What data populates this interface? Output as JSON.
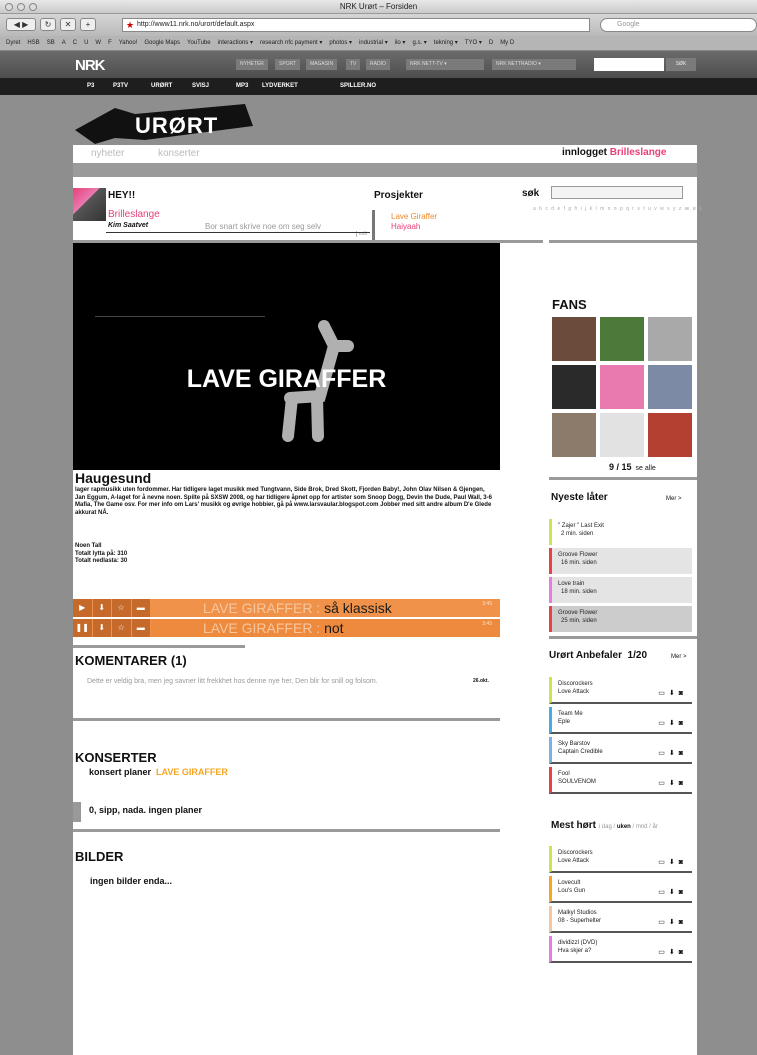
{
  "browser": {
    "window_title": "NRK Urørt – Forsiden",
    "url": "http://www11.nrk.no/urort/default.aspx",
    "search_placeholder": "Google",
    "bookmarks": [
      "Dyret",
      "HSB",
      "SB",
      "A",
      "C",
      "U",
      "W",
      "F",
      "Yahoo!",
      "Google Maps",
      "YouTube",
      "interactions ▾",
      "research nfc payment ▾",
      "photos ▾",
      "industrial ▾",
      "ilo ▾",
      "g.s. ▾",
      "tekning ▾",
      "TYO ▾",
      "D",
      "My D"
    ]
  },
  "nrk": {
    "logo": "NRK",
    "top_buttons": [
      "NYHETER",
      "SPORT",
      "MAGASIN",
      "TV",
      "RADIO"
    ],
    "dropdowns": [
      "NRK NETT-TV",
      "NRK NETTRADIO"
    ],
    "search_button": "SØK",
    "nav": [
      "P3",
      "P3TV",
      "URØRT",
      "SVISJ",
      "MP3",
      "LYDVERKET",
      "SPILLER.NO"
    ]
  },
  "urort": {
    "logo": "URØRT",
    "tabs": [
      "nyheter",
      "konserter"
    ],
    "innlogget_label": "innlogget",
    "user": "Brilleslange"
  },
  "profile": {
    "greeting": "HEY!!",
    "username": "Brilleslange",
    "real_name": "Kim Saatvet",
    "status": "Bor snart skrive noe om seg selv",
    "edit": "edit",
    "projects_header": "Prosjekter",
    "projects": [
      "Lave Giraffer",
      "Haiyaah"
    ],
    "search_label": "søk",
    "alphabet": "a b c d e f g h i j k l m n o p q r s t u v w x y z æ ø å"
  },
  "video": {
    "title": "LAVE GIRAFFER"
  },
  "bio": {
    "title": "Haugesund",
    "text": "lager rapmusikk uten fordommer. Har tidligere laget musikk med Tungtvann, Side Brok, Dred Skott, Fjorden Baby!, John Olav Nilsen & Gjengen, Jan Eggum, A-laget for å nevne noen. Spilte på SXSW 2008, og har tidligere åpnet opp for artister som Snoop Dogg, Devin the Dude, Paul Wall, 3-6 Mafia, The Game osv. For mer info om Lars' musikk og øvrige hobbier, gå på www.larsvaular.blogspot.com Jobber med sitt andre album D'e Glede akkurat NÅ.",
    "stats": [
      "Noen Tall",
      "Totalt lytta på: 310",
      "Totalt nedlasta: 30"
    ]
  },
  "tracks": [
    {
      "artist": "LAVE GIRAFFER",
      "sep": " : ",
      "title": "så klassisk",
      "time": "3:45",
      "play": "▶"
    },
    {
      "artist": "LAVE GIRAFFER",
      "sep": " : ",
      "title": "not",
      "time": "3:45",
      "play": "❚❚"
    }
  ],
  "comments": {
    "header": "KOMENTARER",
    "count": "(1)",
    "items": [
      {
        "text": "Dette er veldig bra, men jeg savner litt frekkhet hos denne nye her, Den blir for snill og folsom.",
        "date": "26.okt."
      }
    ]
  },
  "konserter": {
    "header": "KONSERTER",
    "label": "konsert planer",
    "project": "LAVE GIRAFFER",
    "empty": "0, sipp, nada.  ingen planer"
  },
  "bilder": {
    "header": "BILDER",
    "empty": "ingen bilder enda..."
  },
  "fans": {
    "header": "FANS",
    "count": "9 / 15",
    "see_all": "se alle",
    "colors": [
      "#6b4b3b",
      "#4d7a3a",
      "#a9a9a9",
      "#2a2a2a",
      "#e87ab0",
      "#7d8aa6",
      "#8c7a6a",
      "#e2e2e2",
      "#b34030"
    ]
  },
  "nyeste": {
    "header": "Nyeste låter",
    "more": "Mer >",
    "items": [
      {
        "title": "\" Zajer \" Last Exit",
        "time": "2 min. siden",
        "color": "#c8e84a",
        "bg": "#ffffff"
      },
      {
        "title": "Groove Flower",
        "time": "16 min. siden",
        "color": "#e8404a",
        "bg": "#e4e4e4"
      },
      {
        "title": "Love train",
        "time": "18 min. siden",
        "color": "#e87ae0",
        "bg": "#e4e4e4"
      },
      {
        "title": "Groove Flower",
        "time": "25 min. siden",
        "color": "#e8404a",
        "bg": "#cccccc"
      }
    ]
  },
  "anbefaler": {
    "header": "Urørt Anbefaler",
    "page": "1/20",
    "more": "Mer >",
    "items": [
      {
        "artist": "Discorockers",
        "song": "Love Attack",
        "color": "#c8e84a"
      },
      {
        "artist": "Team Me",
        "song": "Eple",
        "color": "#4aa8e8"
      },
      {
        "artist": "Sky Barstov",
        "song": "Captain Credible",
        "color": "#7ab0e8"
      },
      {
        "artist": "Fool",
        "song": "SOULVENOM",
        "color": "#e8404a"
      }
    ]
  },
  "mesthort": {
    "header": "Mest hørt",
    "periods": [
      "i dag",
      "uken",
      "mnd",
      "år"
    ],
    "active": "uken",
    "items": [
      {
        "artist": "Discorockers",
        "song": "Love Attack",
        "color": "#c8e84a"
      },
      {
        "artist": "Lovecult",
        "song": "Lou's Gun",
        "color": "#f5a623"
      },
      {
        "artist": "Malkyl Studios",
        "song": "08 - Superhelter",
        "color": "#f5c6a0"
      },
      {
        "artist": "dividizzl (DVD)",
        "song": "Hva skjer a?",
        "color": "#e87ae0"
      }
    ]
  },
  "icons": {
    "play": "play-icon",
    "download": "download-icon",
    "star": "star-icon",
    "comment": "comment-icon"
  }
}
